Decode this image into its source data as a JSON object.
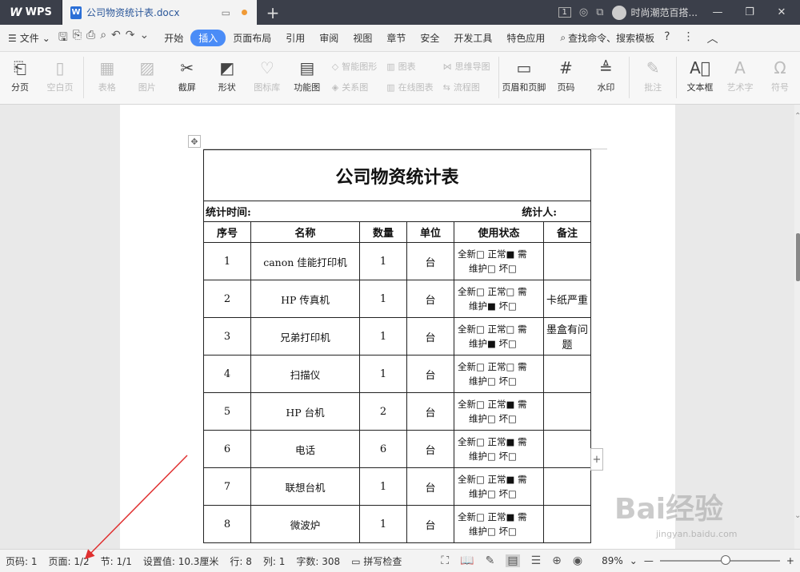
{
  "titlebar": {
    "app_tab": "WPS",
    "doc_tab": "公司物资统计表.docx",
    "badge": "1",
    "user_name": "时尚潮范百搭..."
  },
  "menubar": {
    "file": "文件",
    "items": [
      "开始",
      "插入",
      "页面布局",
      "引用",
      "审阅",
      "视图",
      "章节",
      "安全",
      "开发工具",
      "特色应用"
    ],
    "active": "插入",
    "search": "查找命令、搜索模板"
  },
  "ribbon": {
    "page_break": "分页",
    "blank_page": "空白页",
    "table": "表格",
    "picture": "图片",
    "screenshot": "截屏",
    "shape": "形状",
    "icon_lib": "图标库",
    "func_chart": "功能图",
    "smart_shape": "智能图形",
    "relation_chart": "关系图",
    "chart": "图表",
    "online_chart": "在线图表",
    "mindmap": "思维导图",
    "flowchart": "流程图",
    "header_footer": "页眉和页脚",
    "page_num": "页码",
    "watermark": "水印",
    "comment": "批注",
    "textbox": "文本框",
    "wordart": "艺术字",
    "symbol": "符号"
  },
  "doc": {
    "title": "公司物资统计表",
    "stat_time": "统计时间:",
    "stat_person": "统计人:",
    "headers": [
      "序号",
      "名称",
      "数量",
      "单位",
      "使用状态",
      "备注"
    ],
    "rows": [
      {
        "no": "1",
        "name": "canon 佳能打印机",
        "qty": "1",
        "unit": "台",
        "s1": "全新□ 正常■ 需",
        "s2": "维护□ 坏□",
        "note": ""
      },
      {
        "no": "2",
        "name": "HP 传真机",
        "qty": "1",
        "unit": "台",
        "s1": "全新□ 正常□ 需",
        "s2": "维护■ 坏□",
        "note": "卡纸严重"
      },
      {
        "no": "3",
        "name": "兄弟打印机",
        "qty": "1",
        "unit": "台",
        "s1": "全新□ 正常□ 需",
        "s2": "维护■ 坏□",
        "note": "墨盒有问题"
      },
      {
        "no": "4",
        "name": "扫描仪",
        "qty": "1",
        "unit": "台",
        "s1": "全新□ 正常□ 需",
        "s2": "维护□ 坏□",
        "note": ""
      },
      {
        "no": "5",
        "name": "HP 台机",
        "qty": "2",
        "unit": "台",
        "s1": "全新□ 正常■ 需",
        "s2": "维护□ 坏□",
        "note": ""
      },
      {
        "no": "6",
        "name": "电话",
        "qty": "6",
        "unit": "台",
        "s1": "全新□ 正常■ 需",
        "s2": "维护□ 坏□",
        "note": ""
      },
      {
        "no": "7",
        "name": "联想台机",
        "qty": "1",
        "unit": "台",
        "s1": "全新□ 正常■ 需",
        "s2": "维护□ 坏□",
        "note": ""
      },
      {
        "no": "8",
        "name": "微波炉",
        "qty": "1",
        "unit": "台",
        "s1": "全新□ 正常■ 需",
        "s2": "维护□ 坏□",
        "note": ""
      }
    ]
  },
  "statusbar": {
    "page_code": "页码: 1",
    "page": "页面: 1/2",
    "section": "节: 1/1",
    "setting": "设置值: 10.3厘米",
    "line": "行: 8",
    "col": "列: 1",
    "words": "字数: 308",
    "spell": "拼写检查",
    "zoom": "89%"
  },
  "watermark": {
    "brand": "Bai经验",
    "url": "jingyan.baidu.com"
  },
  "colors": {
    "accent": "#4a8cf7",
    "titlebar": "#3b3f4a",
    "arrow": "#e03030"
  }
}
